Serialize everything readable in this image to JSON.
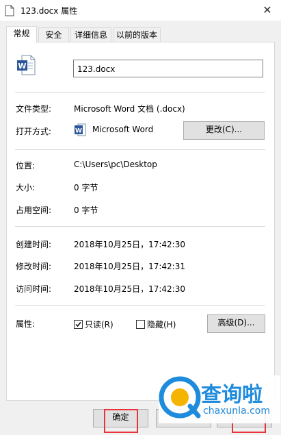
{
  "window": {
    "title": "123.docx 属性",
    "close_glyph": "✕"
  },
  "tabs": [
    "常规",
    "安全",
    "详细信息",
    "以前的版本"
  ],
  "file": {
    "name": "123.docx"
  },
  "fields": {
    "type_label": "文件类型:",
    "type_value": "Microsoft Word 文档 (.docx)",
    "open_label": "打开方式:",
    "open_value": "Microsoft Word",
    "change_button": "更改(C)...",
    "location_label": "位置:",
    "location_value": "C:\\Users\\pc\\Desktop",
    "size_label": "大小:",
    "size_value": "0 字节",
    "disk_label": "占用空间:",
    "disk_value": "0 字节",
    "created_label": "创建时间:",
    "created_value": "2018年10月25日，17:42:30",
    "modified_label": "修改时间:",
    "modified_value": "2018年10月25日，17:42:31",
    "accessed_label": "访问时间:",
    "accessed_value": "2018年10月25日，17:42:30",
    "attr_label": "属性:",
    "readonly_label": "只读(R)",
    "hidden_label": "隐藏(H)",
    "advanced_button": "高级(D)...",
    "readonly_checked": true,
    "hidden_checked": false
  },
  "footer": {
    "ok_button": "确定"
  },
  "watermark": {
    "text": "查询啦",
    "url": "chaxunla.com"
  },
  "colors": {
    "highlight": "#e8323c",
    "word_blue": "#2b579a",
    "watermark_blue": "#1f8bdc",
    "watermark_yellow": "#f5b400"
  }
}
